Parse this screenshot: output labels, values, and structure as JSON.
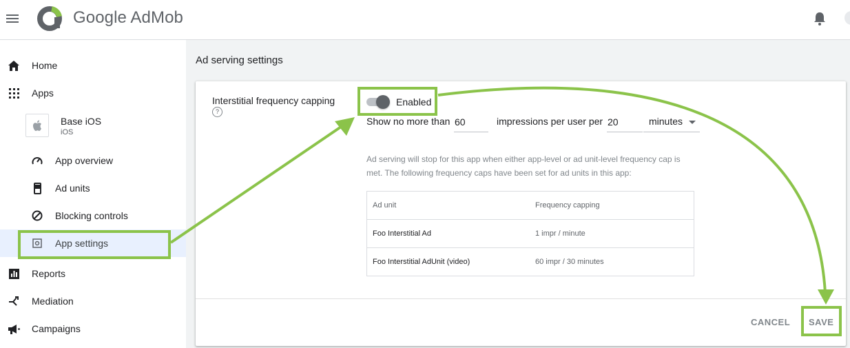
{
  "brand": {
    "logo_text": "Google AdMob"
  },
  "sidebar": {
    "items": [
      {
        "label": "Home",
        "icon": "home-icon"
      },
      {
        "label": "Apps",
        "icon": "apps-grid-icon"
      },
      {
        "label": "Reports",
        "icon": "reports-icon"
      },
      {
        "label": "Mediation",
        "icon": "mediation-icon"
      },
      {
        "label": "Campaigns",
        "icon": "campaigns-icon"
      }
    ],
    "app": {
      "name": "Base iOS",
      "platform": "iOS",
      "icon": "apple-icon"
    },
    "sub_items": [
      {
        "label": "App overview",
        "icon": "speedometer-icon"
      },
      {
        "label": "Ad units",
        "icon": "phone-icon"
      },
      {
        "label": "Blocking controls",
        "icon": "block-icon"
      },
      {
        "label": "App settings",
        "icon": "settings-icon",
        "active": true
      }
    ]
  },
  "page": {
    "title": "Ad serving settings"
  },
  "settings": {
    "label": "Interstitial frequency capping",
    "toggle_state": "Enabled",
    "cap_prefix": "Show no more than",
    "impressions_value": "60",
    "cap_middle": "impressions per user per",
    "duration_value": "20",
    "unit_selected": "minutes",
    "note": "Ad serving will stop for this app when either app-level or ad unit-level frequency cap is met. The following frequency caps have been set for ad units in this app:"
  },
  "table": {
    "headers": [
      "Ad unit",
      "Frequency capping"
    ],
    "rows": [
      [
        "Foo Interstitial Ad",
        "1 impr / minute"
      ],
      [
        "Foo Interstitial AdUnit (video)",
        "60 impr / 30 minutes"
      ]
    ]
  },
  "actions": {
    "cancel": "CANCEL",
    "save": "SAVE"
  },
  "colors": {
    "highlight": "#8bc34a",
    "active_nav": "#e8f0fe"
  }
}
